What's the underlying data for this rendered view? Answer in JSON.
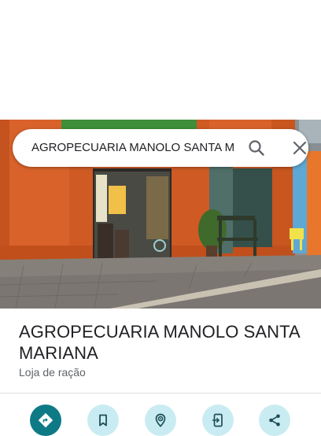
{
  "search": {
    "query": "AGROPECUARIA MANOLO SANTA M"
  },
  "place": {
    "name": "AGROPECUARIA MANOLO SANTA MARIANA",
    "category": "Loja de ração"
  },
  "actions": [
    {
      "icon": "directions-icon"
    },
    {
      "icon": "bookmark-icon"
    },
    {
      "icon": "nearby-icon"
    },
    {
      "icon": "send-to-phone-icon"
    },
    {
      "icon": "share-icon"
    }
  ],
  "colors": {
    "primary_action": "#0e7a86",
    "secondary_action": "#c9ecf2",
    "facade": "#d9622b"
  }
}
